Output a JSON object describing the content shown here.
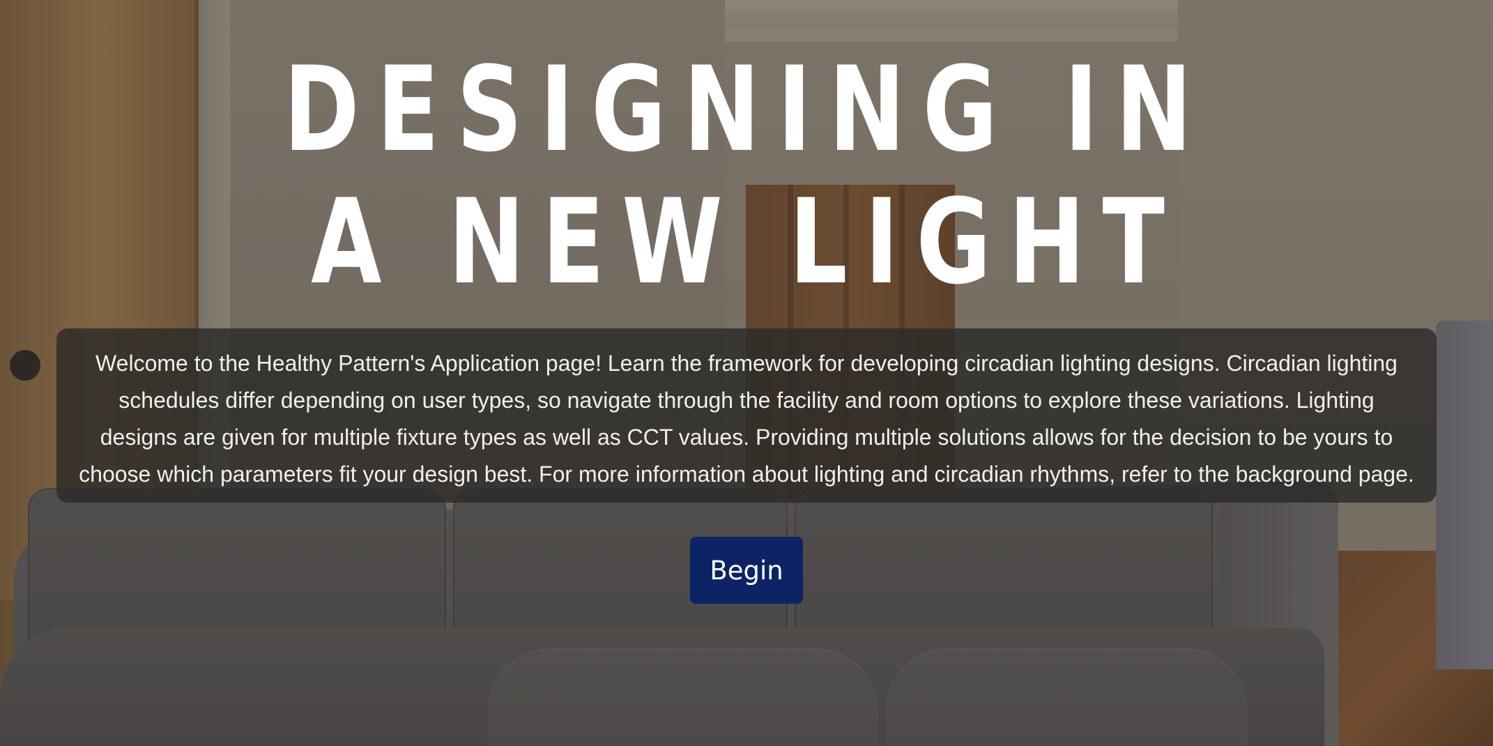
{
  "hero": {
    "title_line1": "DESIGNING IN",
    "title_line2": "A NEW LIGHT",
    "intro_text": "Welcome to the Healthy Pattern's Application page! Learn the framework for developing circadian lighting designs. Circadian lighting schedules differ depending on user types, so navigate through the facility and room options to explore these variations. Lighting designs are given for multiple fixture types as well as CCT values. Providing multiple solutions allows for the decision to be yours to choose which parameters fit your design best. For more information about lighting and circadian rhythms, refer to the background page.",
    "begin_label": "Begin"
  },
  "colors": {
    "title_text": "#ffffff",
    "intro_box_background": "#2c2b2a",
    "intro_text": "#f2f0ed",
    "begin_button_background": "#0c2366",
    "begin_button_text": "#ffffff"
  }
}
